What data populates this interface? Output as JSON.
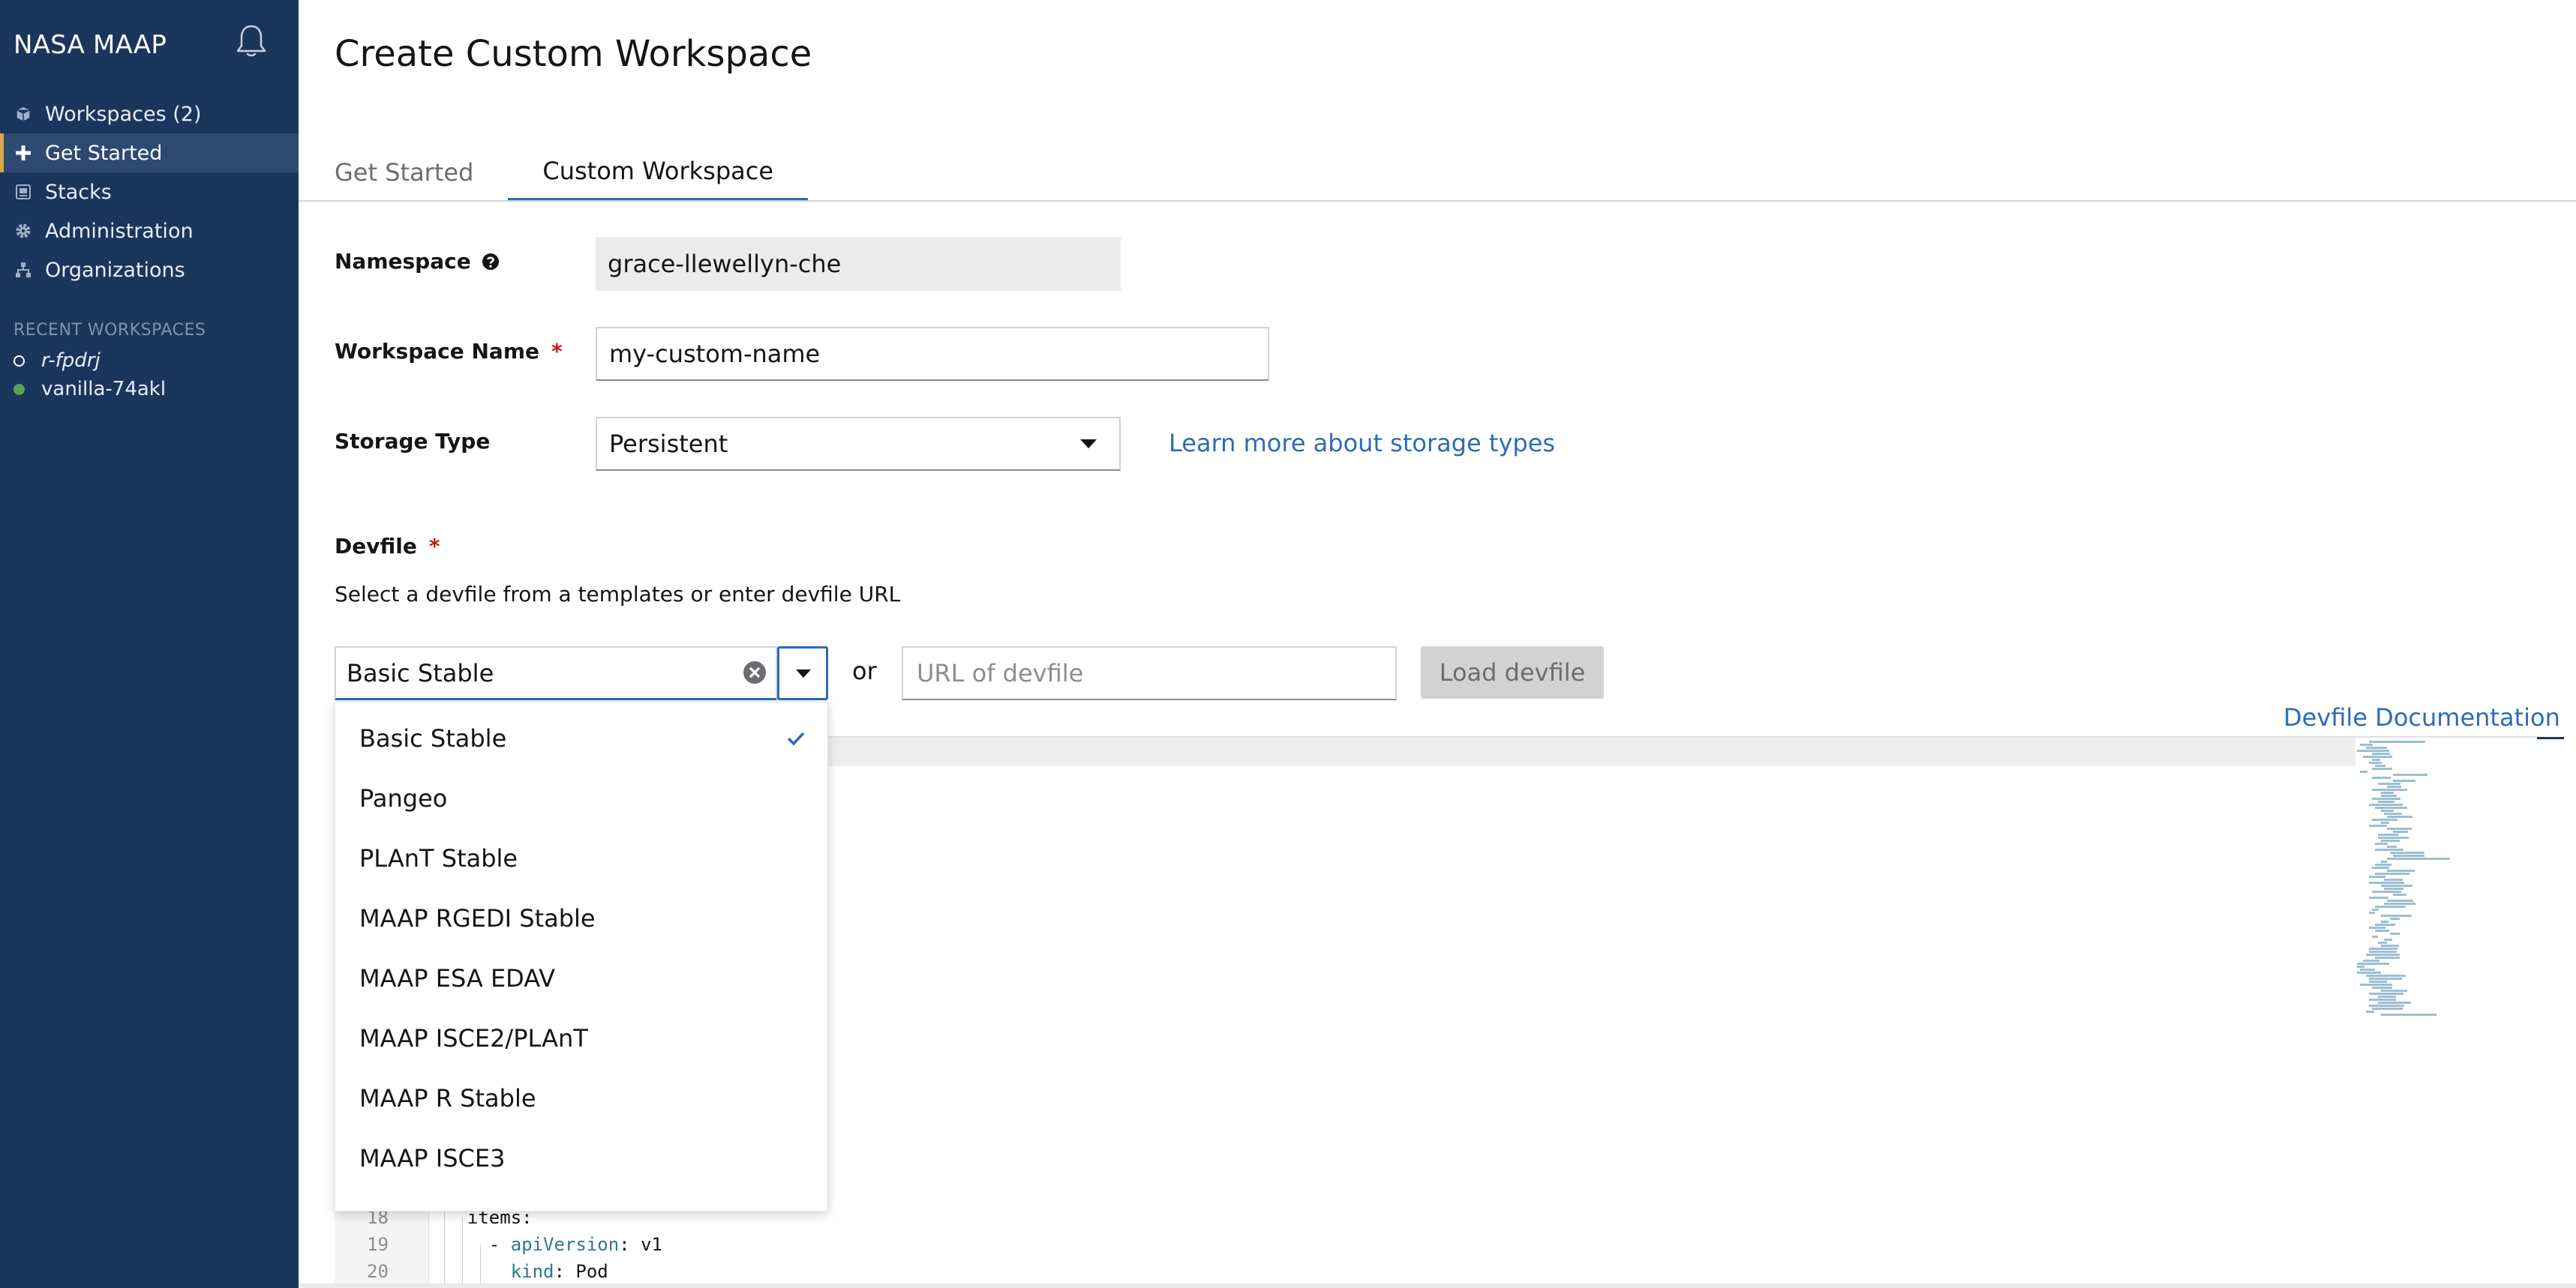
{
  "sidebar": {
    "brand": "NASA MAAP",
    "nav": [
      {
        "label": "Workspaces (2)",
        "icon": "cube-icon"
      },
      {
        "label": "Get Started",
        "icon": "plus-icon"
      },
      {
        "label": "Stacks",
        "icon": "stack-icon"
      },
      {
        "label": "Administration",
        "icon": "gear-icon"
      },
      {
        "label": "Organizations",
        "icon": "sitemap-icon"
      }
    ],
    "active_nav": "Get Started",
    "recent_title": "RECENT WORKSPACES",
    "recent": [
      {
        "label": "r-fpdrj",
        "status": "stopped"
      },
      {
        "label": "vanilla-74akl",
        "status": "running"
      }
    ]
  },
  "page": {
    "title": "Create Custom Workspace",
    "tabs": [
      {
        "label": "Get Started"
      },
      {
        "label": "Custom Workspace"
      }
    ],
    "active_tab": "Custom Workspace"
  },
  "form": {
    "namespace_label": "Namespace",
    "namespace_value": "grace-llewellyn-che",
    "workspace_name_label": "Workspace Name",
    "workspace_name_value": "my-custom-name",
    "required_mark": "*",
    "storage_label": "Storage Type",
    "storage_value": "Persistent",
    "storage_link": "Learn more about storage types",
    "devfile_label": "Devfile",
    "devfile_desc": "Select a devfile from a templates or enter devfile URL",
    "devfile_selected": "Basic Stable",
    "or_text": "or",
    "url_placeholder": "URL of devfile",
    "load_button": "Load devfile",
    "doc_link": "Devfile Documentation"
  },
  "dropdown": {
    "options": [
      "Basic Stable",
      "Pangeo",
      "PLAnT Stable",
      "MAAP RGEDI Stable",
      "MAAP ESA EDAV",
      "MAAP ISCE2/PLAnT",
      "MAAP R Stable",
      "MAAP ISCE3"
    ],
    "selected": "Basic Stable"
  },
  "editor": {
    "lines": [
      {
        "num": "18",
        "indent": "  ",
        "key": "items",
        "sep": ":",
        "rest": ""
      },
      {
        "num": "19",
        "indent": "    - ",
        "key": "apiVersion",
        "sep": ": ",
        "rest": "v1"
      },
      {
        "num": "20",
        "indent": "      ",
        "key": "kind",
        "sep": ": ",
        "rest": "Pod"
      }
    ]
  },
  "colors": {
    "sidebar_bg": "#1b365c",
    "accent": "#2b6cb8",
    "active_marker": "#d8a64b",
    "required": "#c9190b",
    "running": "#5ba352"
  }
}
